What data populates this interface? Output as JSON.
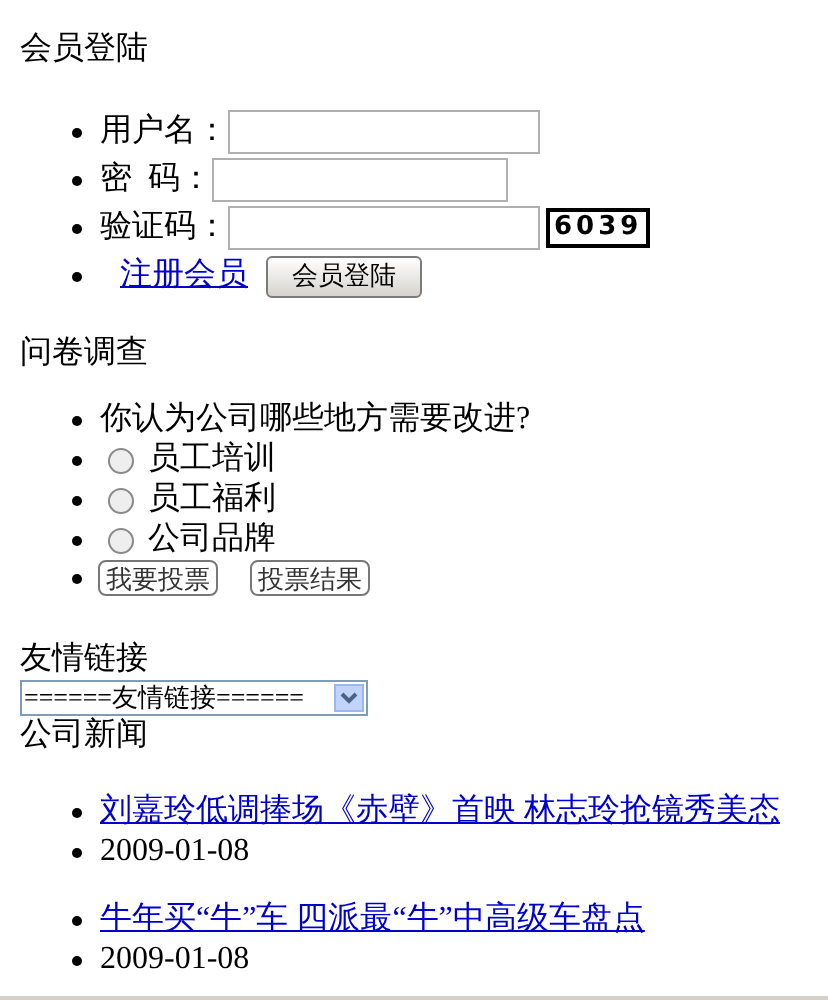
{
  "login": {
    "title": "会员登陆",
    "fields": [
      {
        "label": "用户名：",
        "kind": "text"
      },
      {
        "label": "密  码：",
        "kind": "password"
      },
      {
        "label": "验证码：",
        "kind": "captcha",
        "captcha": "6039"
      }
    ],
    "register_link": "注册会员",
    "submit_button": "会员登陆"
  },
  "survey": {
    "title": "问卷调查",
    "question": "你认为公司哪些地方需要改进?",
    "options": [
      {
        "label": "员工培训",
        "selected": false
      },
      {
        "label": "员工福利",
        "selected": false
      },
      {
        "label": "公司品牌",
        "selected": false
      }
    ],
    "buttons": [
      "我要投票",
      "投票结果"
    ]
  },
  "links": {
    "title": "友情链接",
    "select_value": "======友情链接======"
  },
  "news": {
    "title": "公司新闻",
    "items": [
      {
        "headline": "刘嘉玲低调捧场《赤壁》首映 林志玲抢镜秀美态",
        "date": "2009-01-08"
      },
      {
        "headline": "牛年买“牛”车 四派最“牛”中高级车盘点",
        "date": "2009-01-08"
      }
    ]
  }
}
